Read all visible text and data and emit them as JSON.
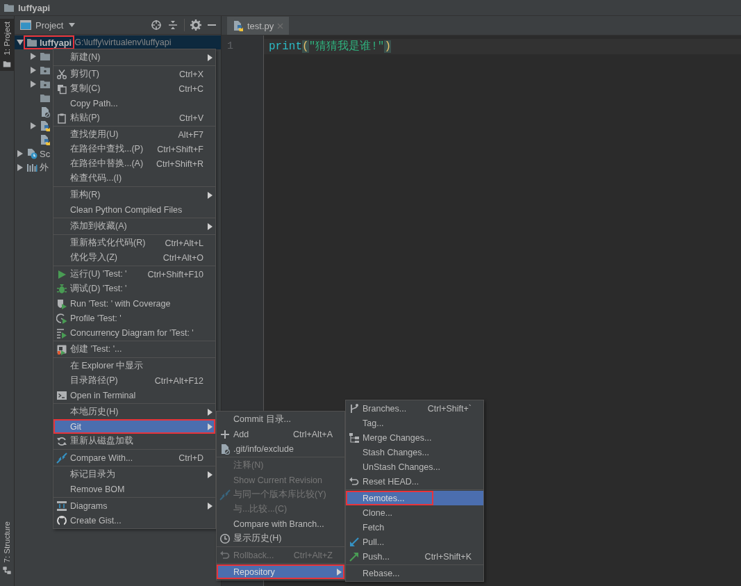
{
  "window": {
    "title": "luffyapi"
  },
  "tool_windows": [
    {
      "label": "1: Project",
      "selected": true
    },
    {
      "label": "7: Structure",
      "selected": false
    }
  ],
  "project_panel": {
    "title": "Project",
    "tree": [
      {
        "label": "luffyapi",
        "path": "G:\\luffy\\virtualenv\\luffyapi",
        "kind": "folder",
        "expanded": true,
        "selected": true,
        "outlined": true,
        "children": [
          {
            "kind": "folder",
            "expanded": false,
            "selected": false,
            "outlined": false
          },
          {
            "kind": "package",
            "expanded": false,
            "selected": false,
            "outlined": false
          },
          {
            "kind": "package",
            "expanded": false,
            "selected": false,
            "outlined": false
          },
          {
            "kind": "folder",
            "selected": false,
            "outlined": false
          },
          {
            "kind": "excluded",
            "selected": false,
            "outlined": false
          },
          {
            "kind": "python",
            "expanded": false,
            "selected": false,
            "outlined": false
          },
          {
            "kind": "python",
            "selected": false,
            "outlined": false
          }
        ]
      },
      {
        "label": "Sc",
        "kind": "scratch",
        "expanded": false,
        "selected": false,
        "outlined": false
      },
      {
        "label": "外",
        "kind": "library",
        "expanded": false,
        "selected": false,
        "outlined": false
      }
    ]
  },
  "editor": {
    "tabs": [
      {
        "label": "test.py",
        "selected": true
      }
    ],
    "lines": [
      {
        "number": "1",
        "tokens": [
          {
            "kind": "function",
            "text": "print",
            "matched": false
          },
          {
            "kind": "paren",
            "text": "(",
            "matched": true
          },
          {
            "kind": "string",
            "text": "\"猜猜我是谁!\"",
            "matched": false
          },
          {
            "kind": "paren",
            "text": ")",
            "matched": true
          }
        ]
      }
    ]
  },
  "context_menu": {
    "items": [
      {
        "kind": "text",
        "label": "新建(N)",
        "submenu": true,
        "selected": false,
        "disabled": false,
        "outlined": false
      },
      {
        "kind": "separator"
      },
      {
        "kind": "scissors",
        "label": "剪切(T)",
        "shortcut": "Ctrl+X",
        "submenu": false,
        "selected": false,
        "disabled": false,
        "outlined": false
      },
      {
        "kind": "copy",
        "label": "复制(C)",
        "shortcut": "Ctrl+C",
        "submenu": false,
        "selected": false,
        "disabled": false,
        "outlined": false
      },
      {
        "kind": "text",
        "label": "Copy Path...",
        "submenu": false,
        "selected": false,
        "disabled": false,
        "outlined": false
      },
      {
        "kind": "paste",
        "label": "粘贴(P)",
        "shortcut": "Ctrl+V",
        "submenu": false,
        "selected": false,
        "disabled": false,
        "outlined": false
      },
      {
        "kind": "separator"
      },
      {
        "kind": "text",
        "label": "查找使用(U)",
        "shortcut": "Alt+F7",
        "submenu": false,
        "selected": false,
        "disabled": false,
        "outlined": false
      },
      {
        "kind": "text",
        "label": "在路径中查找...(P)",
        "shortcut": "Ctrl+Shift+F",
        "submenu": false,
        "selected": false,
        "disabled": false,
        "outlined": false
      },
      {
        "kind": "text",
        "label": "在路径中替换...(A)",
        "shortcut": "Ctrl+Shift+R",
        "submenu": false,
        "selected": false,
        "disabled": false,
        "outlined": false
      },
      {
        "kind": "text",
        "label": "检查代码...(I)",
        "submenu": false,
        "selected": false,
        "disabled": false,
        "outlined": false
      },
      {
        "kind": "separator"
      },
      {
        "kind": "text",
        "label": "重构(R)",
        "submenu": true,
        "selected": false,
        "disabled": false,
        "outlined": false
      },
      {
        "kind": "text",
        "label": "Clean Python Compiled Files",
        "submenu": false,
        "selected": false,
        "disabled": false,
        "outlined": false
      },
      {
        "kind": "separator"
      },
      {
        "kind": "text",
        "label": "添加到收藏(A)",
        "submenu": true,
        "selected": false,
        "disabled": false,
        "outlined": false
      },
      {
        "kind": "separator"
      },
      {
        "kind": "text",
        "label": "重新格式化代码(R)",
        "shortcut": "Ctrl+Alt+L",
        "submenu": false,
        "selected": false,
        "disabled": false,
        "outlined": false
      },
      {
        "kind": "text",
        "label": "优化导入(Z)",
        "shortcut": "Ctrl+Alt+O",
        "submenu": false,
        "selected": false,
        "disabled": false,
        "outlined": false
      },
      {
        "kind": "separator"
      },
      {
        "kind": "run",
        "label": "运行(U) 'Test: '",
        "shortcut": "Ctrl+Shift+F10",
        "submenu": false,
        "selected": false,
        "disabled": false,
        "outlined": false
      },
      {
        "kind": "debug",
        "label": "调试(D) 'Test: '",
        "submenu": false,
        "selected": false,
        "disabled": false,
        "outlined": false
      },
      {
        "kind": "coverage",
        "label": "Run 'Test: ' with Coverage",
        "submenu": false,
        "selected": false,
        "disabled": false,
        "outlined": false
      },
      {
        "kind": "profile",
        "label": "Profile 'Test: '",
        "submenu": false,
        "selected": false,
        "disabled": false,
        "outlined": false
      },
      {
        "kind": "concurrency",
        "label": "Concurrency Diagram for 'Test: '",
        "submenu": false,
        "selected": false,
        "disabled": false,
        "outlined": false
      },
      {
        "kind": "separator"
      },
      {
        "kind": "create",
        "label": "创建 'Test: '...",
        "submenu": false,
        "selected": false,
        "disabled": false,
        "outlined": false
      },
      {
        "kind": "separator"
      },
      {
        "kind": "text",
        "label": "在 Explorer 中显示",
        "submenu": false,
        "selected": false,
        "disabled": false,
        "outlined": false
      },
      {
        "kind": "text",
        "label": "目录路径(P)",
        "shortcut": "Ctrl+Alt+F12",
        "submenu": false,
        "selected": false,
        "disabled": false,
        "outlined": false
      },
      {
        "kind": "terminal",
        "label": "Open in Terminal",
        "submenu": false,
        "selected": false,
        "disabled": false,
        "outlined": false
      },
      {
        "kind": "separator"
      },
      {
        "kind": "text",
        "label": "本地历史(H)",
        "submenu": true,
        "selected": false,
        "disabled": false,
        "outlined": false
      },
      {
        "kind": "text",
        "label": "Git",
        "submenu": true,
        "selected": true,
        "disabled": false,
        "outlined": true
      },
      {
        "kind": "reload",
        "label": "重新从磁盘加载",
        "submenu": false,
        "selected": false,
        "disabled": false,
        "outlined": false
      },
      {
        "kind": "separator"
      },
      {
        "kind": "compare",
        "label": "Compare With...",
        "shortcut": "Ctrl+D",
        "submenu": false,
        "selected": false,
        "disabled": false,
        "outlined": false
      },
      {
        "kind": "separator"
      },
      {
        "kind": "text",
        "label": "标记目录为",
        "submenu": true,
        "selected": false,
        "disabled": false,
        "outlined": false
      },
      {
        "kind": "text",
        "label": "Remove BOM",
        "submenu": false,
        "selected": false,
        "disabled": false,
        "outlined": false
      },
      {
        "kind": "separator"
      },
      {
        "kind": "diagram",
        "label": "Diagrams",
        "submenu": true,
        "selected": false,
        "disabled": false,
        "outlined": false
      },
      {
        "kind": "github",
        "label": "Create Gist...",
        "submenu": false,
        "selected": false,
        "disabled": false,
        "outlined": false
      }
    ]
  },
  "git_submenu": {
    "items": [
      {
        "kind": "text",
        "label": "Commit 目录...",
        "submenu": false,
        "selected": false,
        "disabled": false,
        "outlined": false
      },
      {
        "kind": "plus",
        "label": "Add",
        "shortcut": "Ctrl+Alt+A",
        "submenu": false,
        "selected": false,
        "disabled": false,
        "outlined": false
      },
      {
        "kind": "excluded",
        "label": ".git/info/exclude",
        "submenu": false,
        "selected": false,
        "disabled": false,
        "outlined": false
      },
      {
        "kind": "separator"
      },
      {
        "kind": "text",
        "label": "注释(N)",
        "submenu": false,
        "selected": false,
        "disabled": true,
        "outlined": false
      },
      {
        "kind": "text",
        "label": "Show Current Revision",
        "submenu": false,
        "selected": false,
        "disabled": true,
        "outlined": false
      },
      {
        "kind": "compare",
        "label": "与同一个版本库比较(Y)",
        "submenu": false,
        "selected": false,
        "disabled": true,
        "outlined": false
      },
      {
        "kind": "text",
        "label": "与...比较...(C)",
        "submenu": false,
        "selected": false,
        "disabled": true,
        "outlined": false
      },
      {
        "kind": "text",
        "label": "Compare with Branch...",
        "submenu": false,
        "selected": false,
        "disabled": false,
        "outlined": false
      },
      {
        "kind": "clock",
        "label": "显示历史(H)",
        "submenu": false,
        "selected": false,
        "disabled": false,
        "outlined": false
      },
      {
        "kind": "separator"
      },
      {
        "kind": "undo",
        "label": "Rollback...",
        "shortcut": "Ctrl+Alt+Z",
        "submenu": false,
        "selected": false,
        "disabled": true,
        "outlined": false
      },
      {
        "kind": "separator"
      },
      {
        "kind": "text",
        "label": "Repository",
        "submenu": true,
        "selected": true,
        "disabled": false,
        "outlined": true
      }
    ]
  },
  "repository_submenu": {
    "items": [
      {
        "kind": "branch",
        "label": "Branches...",
        "shortcut": "Ctrl+Shift+`",
        "submenu": false,
        "selected": false,
        "disabled": false,
        "outlined": false
      },
      {
        "kind": "text",
        "label": "Tag...",
        "submenu": false,
        "selected": false,
        "disabled": false,
        "outlined": false
      },
      {
        "kind": "merge",
        "label": "Merge Changes...",
        "submenu": false,
        "selected": false,
        "disabled": false,
        "outlined": false
      },
      {
        "kind": "text",
        "label": "Stash Changes...",
        "submenu": false,
        "selected": false,
        "disabled": false,
        "outlined": false
      },
      {
        "kind": "text",
        "label": "UnStash Changes...",
        "submenu": false,
        "selected": false,
        "disabled": false,
        "outlined": false
      },
      {
        "kind": "undo",
        "label": "Reset HEAD...",
        "submenu": false,
        "selected": false,
        "disabled": false,
        "outlined": false
      },
      {
        "kind": "separator"
      },
      {
        "kind": "text",
        "label": "Remotes...",
        "submenu": false,
        "selected": true,
        "disabled": false,
        "outlined": true
      },
      {
        "kind": "text",
        "label": "Clone...",
        "submenu": false,
        "selected": false,
        "disabled": false,
        "outlined": false
      },
      {
        "kind": "text",
        "label": "Fetch",
        "submenu": false,
        "selected": false,
        "disabled": false,
        "outlined": false
      },
      {
        "kind": "pull",
        "label": "Pull...",
        "submenu": false,
        "selected": false,
        "disabled": false,
        "outlined": false
      },
      {
        "kind": "push",
        "label": "Push...",
        "shortcut": "Ctrl+Shift+K",
        "submenu": false,
        "selected": false,
        "disabled": false,
        "outlined": false
      },
      {
        "kind": "separator"
      },
      {
        "kind": "text",
        "label": "Rebase...",
        "submenu": false,
        "selected": false,
        "disabled": false,
        "outlined": false
      }
    ]
  }
}
